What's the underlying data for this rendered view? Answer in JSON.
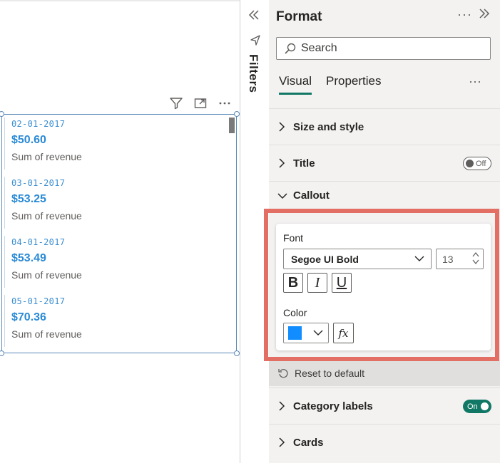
{
  "canvas": {
    "cards": [
      {
        "category": "02-01-2017",
        "value": "$50.60",
        "label": "Sum of revenue"
      },
      {
        "category": "03-01-2017",
        "value": "$53.25",
        "label": "Sum of revenue"
      },
      {
        "category": "04-01-2017",
        "value": "$53.49",
        "label": "Sum of revenue"
      },
      {
        "category": "05-01-2017",
        "value": "$70.36",
        "label": "Sum of revenue"
      }
    ],
    "toolbar_icons": [
      "filter-icon",
      "focus-mode-icon",
      "more-options-icon"
    ]
  },
  "filters": {
    "label": "Filters"
  },
  "format_pane": {
    "title": "Format",
    "more": "···",
    "search": {
      "placeholder": "Search",
      "value": ""
    },
    "tabs": [
      {
        "label": "Visual",
        "active": true
      },
      {
        "label": "Properties",
        "active": false
      }
    ],
    "tabs_more": "···",
    "sections": {
      "size_style": {
        "label": "Size and style"
      },
      "title": {
        "label": "Title",
        "toggle": "Off"
      },
      "callout": {
        "label": "Callout"
      },
      "category_labels": {
        "label": "Category labels",
        "toggle": "On"
      },
      "cards": {
        "label": "Cards"
      }
    },
    "callout": {
      "font_label": "Font",
      "font_family": "Segoe UI Bold",
      "font_size": "13",
      "bold": "B",
      "italic": "I",
      "underline": "U",
      "color_label": "Color",
      "color_value": "#118dff",
      "fx": "fx",
      "reset_label": "Reset to default"
    }
  },
  "colors": {
    "accent": "#117865",
    "card_text": "#2a8ad6",
    "highlight": "#e36e63"
  }
}
